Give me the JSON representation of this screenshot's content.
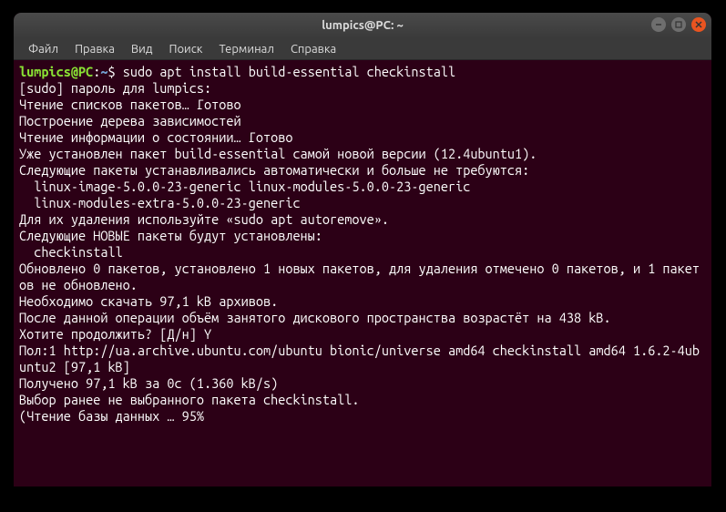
{
  "window": {
    "title": "lumpics@PC: ~"
  },
  "menu": {
    "file": "Файл",
    "edit": "Правка",
    "view": "Вид",
    "search": "Поиск",
    "terminal": "Терминал",
    "help": "Справка"
  },
  "prompt": {
    "user_host": "lumpics@PC",
    "sep1": ":",
    "path": "~",
    "sep2": "$ "
  },
  "command": "sudo apt install build-essential checkinstall",
  "output": {
    "l1": "[sudo] пароль для lumpics:",
    "l2": "Чтение списков пакетов… Готово",
    "l3": "Построение дерева зависимостей",
    "l4": "Чтение информации о состоянии… Готово",
    "l5": "Уже установлен пакет build-essential самой новой версии (12.4ubuntu1).",
    "l6": "Следующие пакеты устанавливались автоматически и больше не требуются:",
    "l7": "  linux-image-5.0.0-23-generic linux-modules-5.0.0-23-generic",
    "l8": "  linux-modules-extra-5.0.0-23-generic",
    "l9": "Для их удаления используйте «sudo apt autoremove».",
    "l10": "Следующие НОВЫЕ пакеты будут установлены:",
    "l11": "  checkinstall",
    "l12": "Обновлено 0 пакетов, установлено 1 новых пакетов, для удаления отмечено 0 пакетов, и 1 пакетов не обновлено.",
    "l13": "Необходимо скачать 97,1 kB архивов.",
    "l14": "После данной операции объём занятого дискового пространства возрастёт на 438 kB.",
    "l15": "Хотите продолжить? [Д/н] Y",
    "l16": "Пол:1 http://ua.archive.ubuntu.com/ubuntu bionic/universe amd64 checkinstall amd64 1.6.2-4ubuntu2 [97,1 kB]",
    "l17": "Получено 97,1 kB за 0с (1.360 kB/s)",
    "l18": "Выбор ранее не выбранного пакета checkinstall.",
    "l19": "(Чтение базы данных … 95%"
  }
}
